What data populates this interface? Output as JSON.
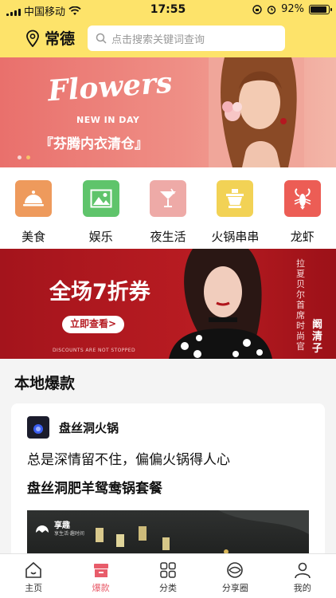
{
  "status_bar": {
    "carrier": "中国移动",
    "time": "17:55",
    "battery_text": "92%",
    "battery_level": 0.92
  },
  "header": {
    "city": "常德",
    "search_placeholder": "点击搜索关键词查询",
    "icons": [
      "location-pin-icon",
      "search-icon"
    ],
    "bg_color": "#fde36a"
  },
  "banner1": {
    "headline": "Flowers",
    "sub": "NEW IN DAY",
    "promo": "『芬腾内衣清仓』",
    "page_count": 2,
    "active_page": 2
  },
  "categories": [
    {
      "label": "美食",
      "icon": "food-cloche-icon",
      "color": "#ee9a5c"
    },
    {
      "label": "娱乐",
      "icon": "image-icon",
      "color": "#5fc46b"
    },
    {
      "label": "夜生活",
      "icon": "cocktail-icon",
      "color": "#eeaaa7"
    },
    {
      "label": "火锅串串",
      "icon": "hotpot-icon",
      "color": "#f2d255"
    },
    {
      "label": "龙虾",
      "icon": "lobster-icon",
      "color": "#ec5d55"
    }
  ],
  "banner2": {
    "headline": "全场7折券",
    "button": "立即查看>",
    "footer": "DISCOUNTS ARE NOT STOPPED",
    "vertical_text": "拉夏贝尔首席时尚官",
    "vertical_name": "阚清子"
  },
  "local": {
    "section_title": "本地爆款",
    "card": {
      "shop_name": "盘丝洞火锅",
      "slogan": "总是深情留不住，偏偏火锅得人心",
      "deal_title": "盘丝洞肥羊鸳鸯锅套餐",
      "photo_brand": "享趣",
      "photo_brand_sub": "享生活·趣时间"
    }
  },
  "tabbar": {
    "active_color": "#e85c6a",
    "tabs": [
      {
        "label": "主页",
        "icon": "home-icon",
        "active": false
      },
      {
        "label": "爆款",
        "icon": "shop-icon",
        "active": true
      },
      {
        "label": "分类",
        "icon": "grid-icon",
        "active": false
      },
      {
        "label": "分享圈",
        "icon": "share-circle-icon",
        "active": false
      },
      {
        "label": "我的",
        "icon": "user-icon",
        "active": false
      }
    ]
  }
}
